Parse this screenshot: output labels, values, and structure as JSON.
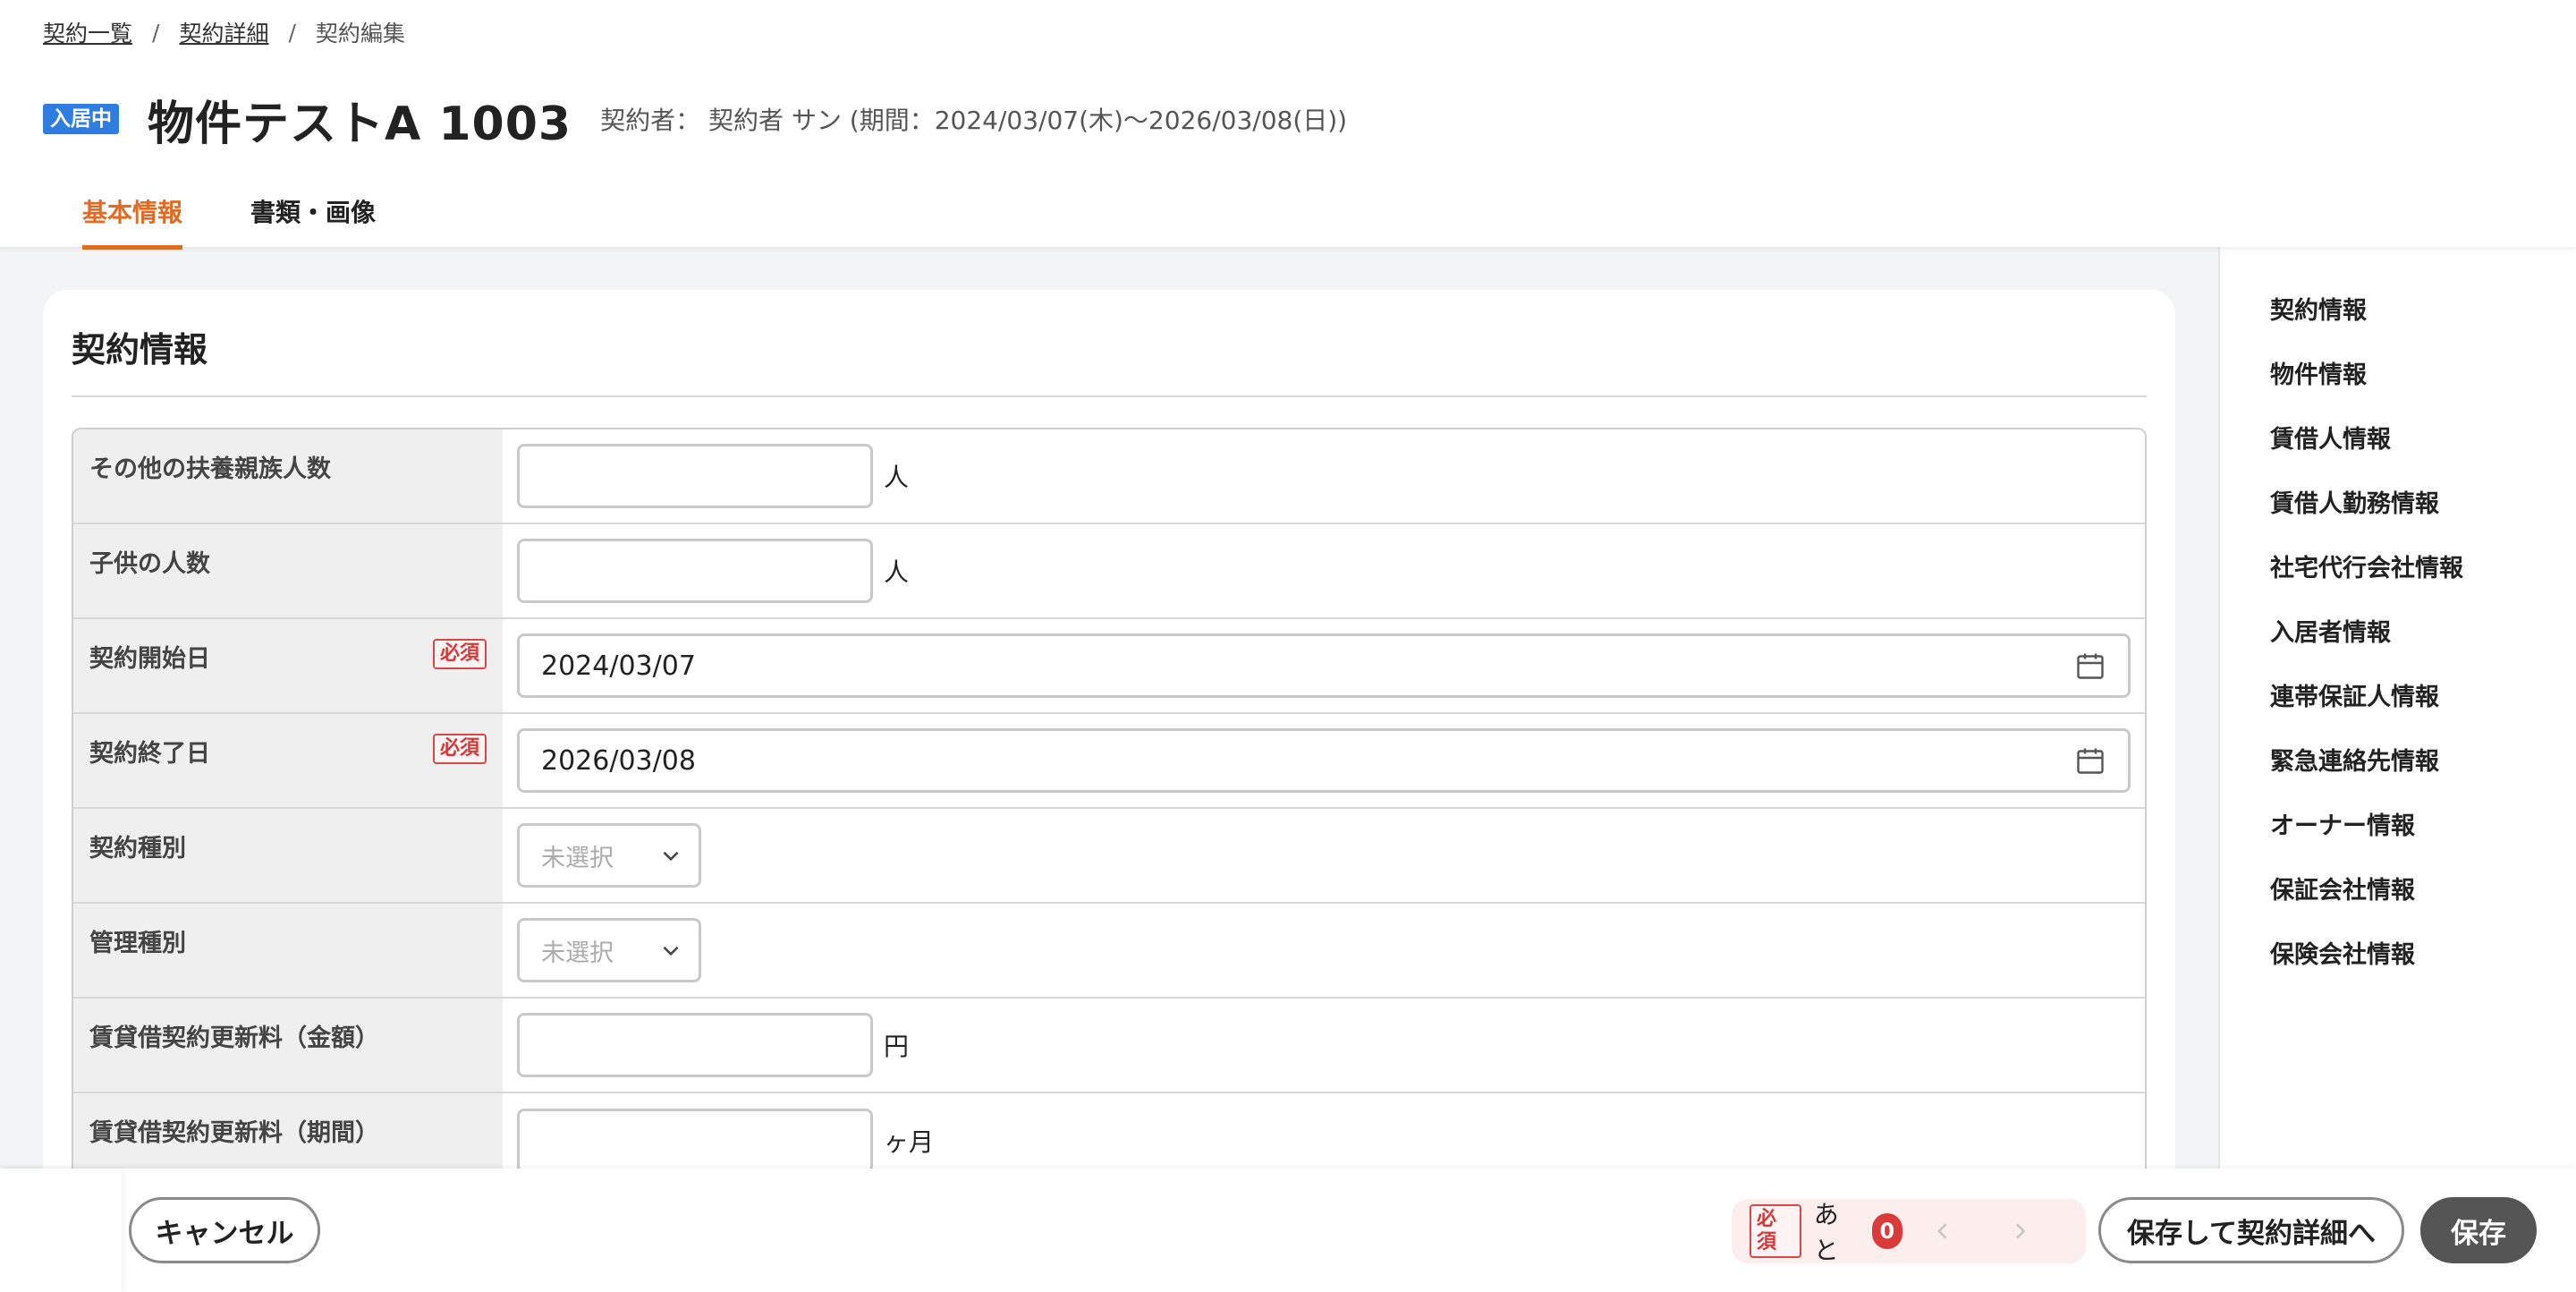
{
  "breadcrumb": {
    "items": [
      "契約一覧",
      "契約詳細"
    ],
    "current": "契約編集",
    "sep": "/"
  },
  "header": {
    "status_badge": "入居中",
    "status_color": "#2f7de1",
    "property_name": "物件テストA 1003",
    "contract_meta": "契約者： 契約者 サン (期間：2024/03/07(木)〜2026/03/08(日))"
  },
  "tabs": [
    {
      "label": "基本情報",
      "active": true
    },
    {
      "label": "書類・画像",
      "active": false
    }
  ],
  "accent_color": "#e06b25",
  "section": {
    "title": "契約情報",
    "required_label": "必須",
    "rows": [
      {
        "label": "その他の扶養親族人数",
        "type": "text",
        "value": "",
        "unit": "人"
      },
      {
        "label": "子供の人数",
        "type": "text",
        "value": "",
        "unit": "人"
      },
      {
        "label": "契約開始日",
        "type": "date",
        "value": "2024/03/07",
        "required": true
      },
      {
        "label": "契約終了日",
        "type": "date",
        "value": "2026/03/08",
        "required": true
      },
      {
        "label": "契約種別",
        "type": "select",
        "value": "未選択"
      },
      {
        "label": "管理種別",
        "type": "select",
        "value": "未選択"
      },
      {
        "label": "賃貸借契約更新料（金額）",
        "type": "text",
        "value": "",
        "unit": "円"
      },
      {
        "label": "賃貸借契約更新料（期間）",
        "type": "text",
        "value": "",
        "unit": "ヶ月"
      }
    ]
  },
  "side_nav": {
    "items": [
      "契約情報",
      "物件情報",
      "賃借人情報",
      "賃借人勤務情報",
      "社宅代行会社情報",
      "入居者情報",
      "連帯保証人情報",
      "緊急連絡先情報",
      "オーナー情報",
      "保証会社情報",
      "保険会社情報"
    ]
  },
  "bottom_bar": {
    "cancel_label": "キャンセル",
    "required_label": "必須",
    "remaining_text": "あと",
    "remaining_count": "0",
    "save_detail_label": "保存して契約詳細へ",
    "save_label": "保存"
  },
  "icons": {
    "calendar": "calendar-icon",
    "chevron_down": "chevron-down-icon",
    "chevron_left": "chevron-left-icon",
    "chevron_right": "chevron-right-icon"
  }
}
